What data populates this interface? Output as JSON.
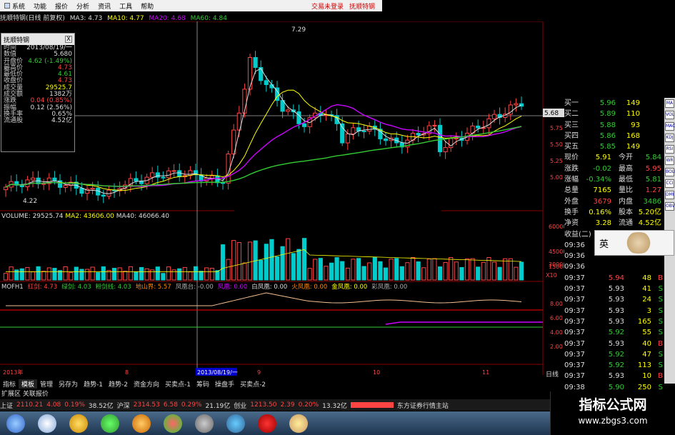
{
  "menu": {
    "items": [
      "系统",
      "功能",
      "报价",
      "分析",
      "资讯",
      "工具",
      "帮助"
    ],
    "trade_login": "交易未登录",
    "stock_name": "抚顺特钢"
  },
  "title": {
    "name": "抚顺特钢(日线 前复权)",
    "ma3": "MA3: 4.73",
    "ma10": "MA10: 4.77",
    "ma20": "MA20: 4.68",
    "ma60": "MA60: 4.84"
  },
  "infobox": {
    "title": "抚顺特钢",
    "close": "X",
    "rows": [
      {
        "k": "时间",
        "v": "2013/08/19/一",
        "c": "#ddd"
      },
      {
        "k": "数值",
        "v": "5.680",
        "c": "#ddd"
      },
      {
        "k": "开盘价",
        "v": "4.62 (-1.49%)",
        "c": "#3c3"
      },
      {
        "k": "最高价",
        "v": "4.73",
        "c": "#f44"
      },
      {
        "k": "最低价",
        "v": "4.61",
        "c": "#3c3"
      },
      {
        "k": "收盘价",
        "v": "4.73",
        "c": "#f44"
      },
      {
        "k": "成交量",
        "v": "29525.7",
        "c": "#ff0"
      },
      {
        "k": "成交额",
        "v": "1382万",
        "c": "#ddd"
      },
      {
        "k": "涨跌",
        "v": "0.04 (0.85%)",
        "c": "#f44"
      },
      {
        "k": "振幅",
        "v": "0.12 (2.56%)",
        "c": "#ddd"
      },
      {
        "k": "换手率",
        "v": "0.65%",
        "c": "#ddd"
      },
      {
        "k": "流通股",
        "v": "4.52亿",
        "c": "#ddd"
      }
    ]
  },
  "price_chart": {
    "high_label": "7.29",
    "low_label": "4.22",
    "cursor_price": "5.68",
    "axis": [
      "5.75",
      "5.50",
      "5.25",
      "5.00"
    ]
  },
  "volume": {
    "title": "VOLUME: 29525.74",
    "ma2": "MA2: 43606.00",
    "ma40": "MA40: 46066.40",
    "axis": [
      "60000",
      "45000",
      "30000",
      "15000"
    ],
    "unit": "X10"
  },
  "indicator": {
    "name": "MOFH1",
    "items": [
      {
        "label": "红剑: 4.73",
        "color": "#f44"
      },
      {
        "label": "绿剑: 4.03",
        "color": "#3c3"
      },
      {
        "label": "粉剑线: 4.03",
        "color": "#3c3"
      },
      {
        "label": "地山界: 5.57",
        "color": "#f80"
      },
      {
        "label": "凤凰台: -0.00",
        "color": "#aaa"
      },
      {
        "label": "凤凰: 0.00",
        "color": "#c0f"
      },
      {
        "label": "白凤凰: 0.00",
        "color": "#ddd"
      },
      {
        "label": "火凤凰: 0.00",
        "color": "#f80"
      },
      {
        "label": "金凤凰: 0.00",
        "color": "#ff0"
      },
      {
        "label": "彩凤凰: 0.00",
        "color": "#aaa"
      }
    ],
    "axis": [
      "8.00",
      "6.00",
      "4.00",
      "2.00"
    ]
  },
  "date_axis": {
    "labels": [
      "2013年",
      "8",
      "9",
      "10",
      "11"
    ],
    "cursor_date": "2013/08/19/一",
    "right": "日线"
  },
  "quote": {
    "sells": [
      {
        "name": "卖五",
        "price": "5.96",
        "vol": "149"
      },
      {
        "name": "卖四",
        "price": "5.89",
        "vol": "110"
      },
      {
        "name": "卖三",
        "price": "5.88",
        "vol": "93"
      },
      {
        "name": "卖二",
        "price": "5.86",
        "vol": "168"
      },
      {
        "name": "卖一",
        "price": "5.85",
        "vol": "149"
      }
    ],
    "buy_labels": [
      "买一",
      "买二",
      "买三",
      "买四",
      "买五"
    ],
    "stats": [
      {
        "l1": "现价",
        "v1": "5.91",
        "c1": "#ff0",
        "l2": "今开",
        "v2": "5.84",
        "c2": "#3c3"
      },
      {
        "l1": "涨跌",
        "v1": "-0.02",
        "c1": "#3c3",
        "l2": "最高",
        "v2": "5.95",
        "c2": "#f44"
      },
      {
        "l1": "涨幅",
        "v1": "-0.34%",
        "c1": "#3c3",
        "l2": "最低",
        "v2": "5.81",
        "c2": "#3c3"
      },
      {
        "l1": "总量",
        "v1": "7165",
        "c1": "#ff0",
        "l2": "量比",
        "v2": "1.27",
        "c2": "#f44"
      },
      {
        "l1": "外盘",
        "v1": "3679",
        "c1": "#f44",
        "l2": "内盘",
        "v2": "3486",
        "c2": "#3c3"
      },
      {
        "l1": "换手",
        "v1": "0.16%",
        "c1": "#ff0",
        "l2": "股本",
        "v2": "5.20亿",
        "c2": "#ff0"
      },
      {
        "l1": "净资",
        "v1": "3.28",
        "c1": "#ff0",
        "l2": "流通",
        "v2": "4.52亿",
        "c2": "#ff0"
      }
    ],
    "eps_label": "收益(二)",
    "trades": [
      {
        "t": "09:36",
        "p": "",
        "v": "",
        "s": "",
        "pc": "#ddd"
      },
      {
        "t": "09:36",
        "p": "",
        "v": "",
        "s": "",
        "pc": "#ddd"
      },
      {
        "t": "09:36",
        "p": "",
        "v": "",
        "s": "",
        "pc": "#ddd"
      },
      {
        "t": "09:37",
        "p": "5.94",
        "v": "48",
        "s": "B",
        "pc": "#f44"
      },
      {
        "t": "09:37",
        "p": "5.93",
        "v": "41",
        "s": "S",
        "pc": "#ddd"
      },
      {
        "t": "09:37",
        "p": "5.93",
        "v": "24",
        "s": "S",
        "pc": "#ddd"
      },
      {
        "t": "09:37",
        "p": "5.93",
        "v": "3",
        "s": "S",
        "pc": "#ddd"
      },
      {
        "t": "09:37",
        "p": "5.93",
        "v": "165",
        "s": "S",
        "pc": "#ddd"
      },
      {
        "t": "09:37",
        "p": "5.92",
        "v": "55",
        "s": "S",
        "pc": "#3c3"
      },
      {
        "t": "09:37",
        "p": "5.93",
        "v": "40",
        "s": "B",
        "pc": "#ddd"
      },
      {
        "t": "09:37",
        "p": "5.92",
        "v": "47",
        "s": "S",
        "pc": "#3c3"
      },
      {
        "t": "09:37",
        "p": "5.92",
        "v": "113",
        "s": "S",
        "pc": "#3c3"
      },
      {
        "t": "09:37",
        "p": "5.93",
        "v": "10",
        "s": "B",
        "pc": "#ddd"
      },
      {
        "t": "09:38",
        "p": "5.90",
        "v": "250",
        "s": "S",
        "pc": "#3c3"
      },
      {
        "t": "09:38",
        "p": "5.91",
        "v": "13",
        "s": "B",
        "pc": "#3c3"
      }
    ]
  },
  "popup": {
    "label": "英"
  },
  "tabs": [
    "指标",
    "模板",
    "管理",
    "另存为",
    "趋势-1",
    "趋势-2",
    "资金方向",
    "买卖点-1",
    "筹码",
    "操盘手",
    "买卖点-2"
  ],
  "tabs_row2": "扩展区  关联报价",
  "status": {
    "sh_label": "上证",
    "sh": "2110.21",
    "sh_chg": "4.08",
    "sh_pct": "0.19%",
    "sh_amt": "38.52亿",
    "hs_label": "沪深",
    "hs": "2314.53",
    "hs_chg": "6.58",
    "hs_pct": "0.29%",
    "hs_amt": "21.19亿",
    "cy_label": "创业",
    "cy": "1213.50",
    "cy_chg": "2.39",
    "cy_pct": "0.20%",
    "cy_amt": "13.32亿",
    "broker": "东方证券行情主站"
  },
  "watermark": {
    "line1": "指标公式网",
    "line2": "www.zbgs3.com"
  },
  "sidebar": [
    "MA",
    "VOL",
    "MACD",
    "KDJ",
    "RSI",
    "WR",
    "BOLL",
    "CCI",
    "DMI",
    "OBV"
  ]
}
